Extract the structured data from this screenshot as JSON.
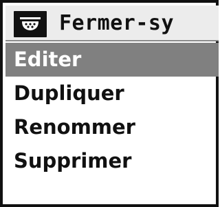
{
  "title_bar": {
    "icon": "settings-icon",
    "title": "Fermer-sy"
  },
  "menu": {
    "items": [
      {
        "label": "Editer",
        "selected": true
      },
      {
        "label": "Dupliquer",
        "selected": false
      },
      {
        "label": "Renommer",
        "selected": false
      },
      {
        "label": "Supprimer",
        "selected": false
      }
    ]
  },
  "colors": {
    "selected_background": "#808080",
    "selected_text": "#ffffff",
    "text": "#111111",
    "border": "#111111",
    "title_background": "#ececec"
  }
}
